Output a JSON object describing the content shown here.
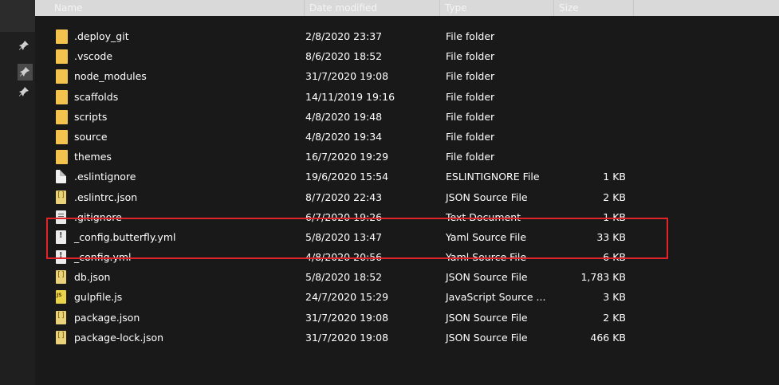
{
  "header": {
    "name": "Name",
    "date_modified": "Date modified",
    "type": "Type",
    "size": "Size"
  },
  "nav": {
    "pins": [
      "pin-icon",
      "pin-icon",
      "pin-icon"
    ]
  },
  "files": [
    {
      "name": ".deploy_git",
      "date": "2/8/2020 23:37",
      "type": "File folder",
      "size": "",
      "icon": "folder"
    },
    {
      "name": ".vscode",
      "date": "8/6/2020 18:52",
      "type": "File folder",
      "size": "",
      "icon": "folder"
    },
    {
      "name": "node_modules",
      "date": "31/7/2020 19:08",
      "type": "File folder",
      "size": "",
      "icon": "folder"
    },
    {
      "name": "scaffolds",
      "date": "14/11/2019 19:16",
      "type": "File folder",
      "size": "",
      "icon": "folder"
    },
    {
      "name": "scripts",
      "date": "4/8/2020 19:48",
      "type": "File folder",
      "size": "",
      "icon": "folder"
    },
    {
      "name": "source",
      "date": "4/8/2020 19:34",
      "type": "File folder",
      "size": "",
      "icon": "folder"
    },
    {
      "name": "themes",
      "date": "16/7/2020 19:29",
      "type": "File folder",
      "size": "",
      "icon": "folder"
    },
    {
      "name": ".eslintignore",
      "date": "19/6/2020 15:54",
      "type": "ESLINTIGNORE File",
      "size": "1 KB",
      "icon": "doc"
    },
    {
      "name": ".eslintrc.json",
      "date": "8/7/2020 22:43",
      "type": "JSON Source File",
      "size": "2 KB",
      "icon": "json"
    },
    {
      "name": ".gitignore",
      "date": "6/7/2020 19:26",
      "type": "Text Document",
      "size": "1 KB",
      "icon": "txt"
    },
    {
      "name": "_config.butterfly.yml",
      "date": "5/8/2020 13:47",
      "type": "Yaml Source File",
      "size": "33 KB",
      "icon": "yaml"
    },
    {
      "name": "_config.yml",
      "date": "4/8/2020 20:56",
      "type": "Yaml Source File",
      "size": "6 KB",
      "icon": "yaml"
    },
    {
      "name": "db.json",
      "date": "5/8/2020 18:52",
      "type": "JSON Source File",
      "size": "1,783 KB",
      "icon": "json"
    },
    {
      "name": "gulpfile.js",
      "date": "24/7/2020 15:29",
      "type": "JavaScript Source ...",
      "size": "3 KB",
      "icon": "js"
    },
    {
      "name": "package.json",
      "date": "31/7/2020 19:08",
      "type": "JSON Source File",
      "size": "2 KB",
      "icon": "json"
    },
    {
      "name": "package-lock.json",
      "date": "31/7/2020 19:08",
      "type": "JSON Source File",
      "size": "466 KB",
      "icon": "json"
    }
  ],
  "colors": {
    "background": "#191919",
    "header": "#d9d9d9",
    "folder": "#f3c34d",
    "highlight_box": "#e0242a"
  }
}
